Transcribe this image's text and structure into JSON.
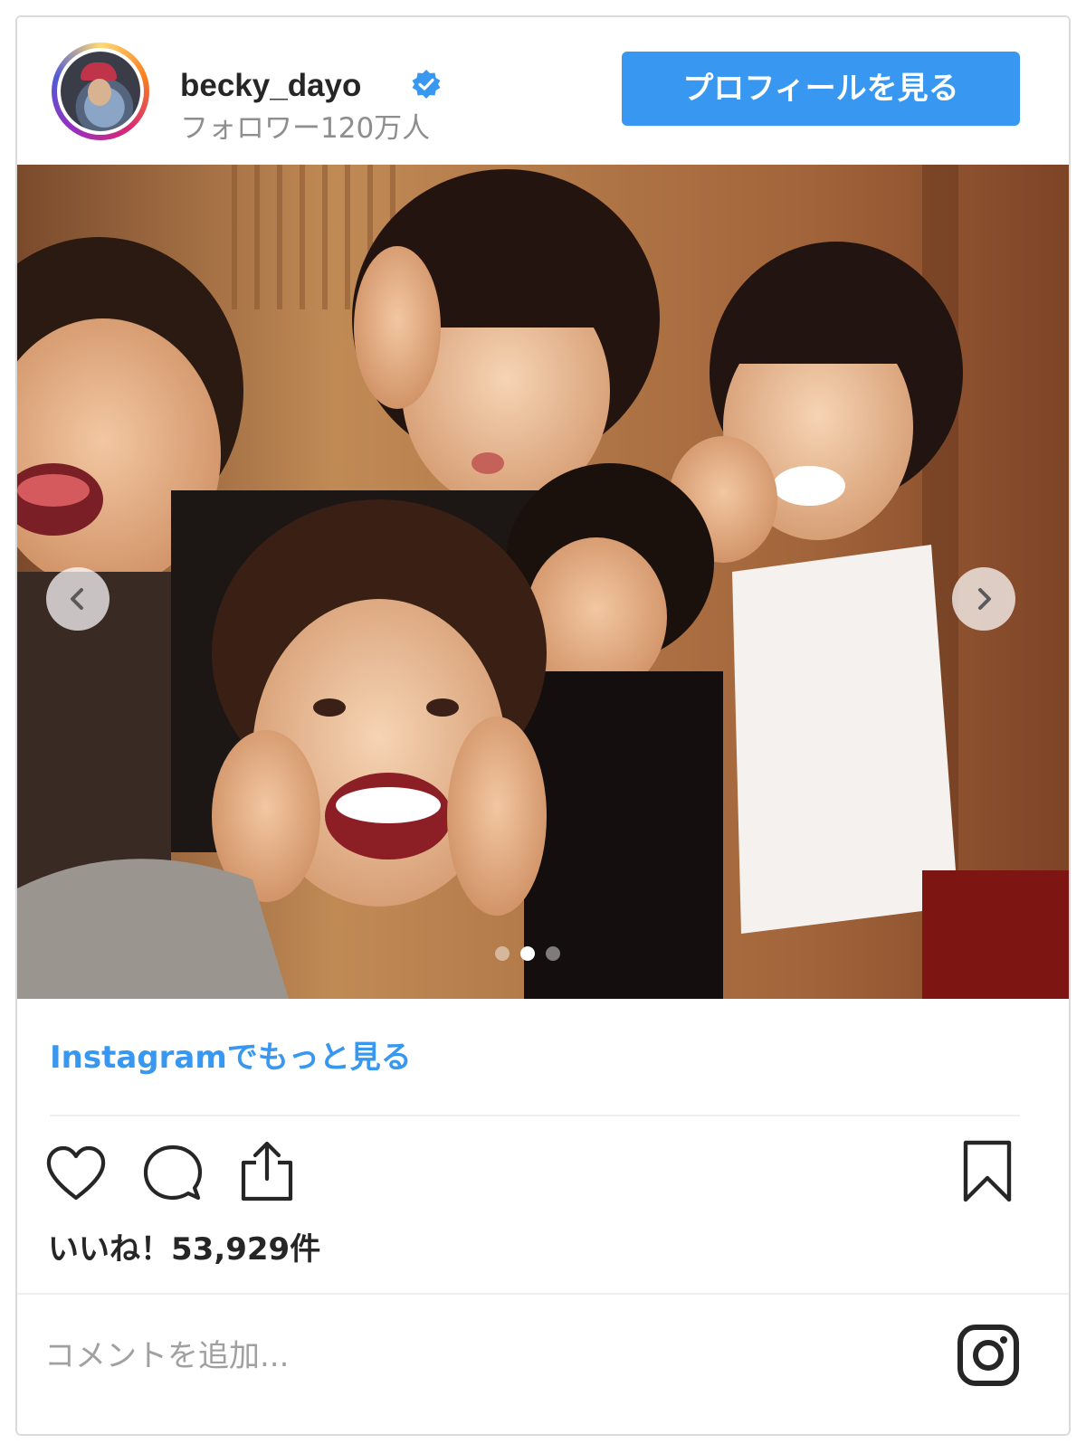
{
  "header": {
    "username": "becky_dayo",
    "followers": "フォロワー120万人",
    "profile_button": "プロフィールを見る"
  },
  "carousel": {
    "slide_count": 3,
    "active_index": 1,
    "prev_icon": "chevron-left-icon",
    "next_icon": "chevron-right-icon"
  },
  "more_link": "Instagramでもっと見る",
  "actions": {
    "like_icon": "heart-icon",
    "comment_icon": "comment-icon",
    "share_icon": "share-icon",
    "save_icon": "bookmark-icon"
  },
  "likes": "いいね！53,929件",
  "comment": {
    "placeholder": "コメントを追加..."
  },
  "colors": {
    "accent": "#3897f0",
    "text": "#262626",
    "muted": "#8e8e8e",
    "border": "#dbdbdb"
  }
}
